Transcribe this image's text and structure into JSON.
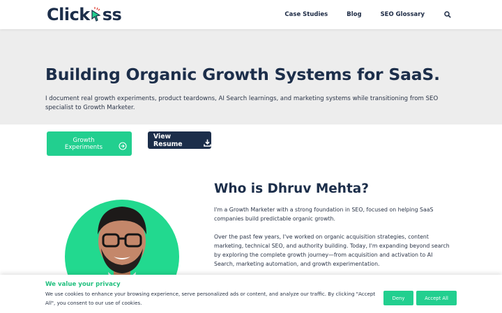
{
  "header": {
    "logo": {
      "text_left": "Click",
      "text_right": "ss",
      "icon": "cursor-icon"
    },
    "nav": [
      {
        "label": "Case Studies"
      },
      {
        "label": "Blog"
      },
      {
        "label": "SEO Glossary"
      }
    ],
    "search_icon": "search-icon"
  },
  "hero": {
    "title": "Building Organic Growth Systems for SaaS.",
    "subtitle": "I document real growth experiments, product teardowns, AI Search learnings, and marketing systems while transitioning from SEO specialist to Growth Marketer."
  },
  "buttons": {
    "primary_label": "Growth Experiments",
    "primary_icon": "arrow-right-circle-icon",
    "secondary_label": "View Resume",
    "secondary_icon": "download-icon"
  },
  "about": {
    "title": "Who is Dhruv Mehta?",
    "paragraph1": "I'm a Growth Marketer with a strong foundation in SEO, focused on helping SaaS companies build predictable organic growth.",
    "paragraph2": "Over the past few years, I've worked on organic acquisition strategies, content marketing, technical SEO, and authority building. Today, I'm expanding beyond search by exploring the complete growth journey—from acquisition and activation to AI Search, marketing automation, and growth experimentation."
  },
  "cookie": {
    "title": "We value your privacy",
    "text": "We use cookies to enhance your browsing experience, serve personalized ads or content, and analyze our traffic. By clicking \"Accept All\", you consent to our use of cookies.",
    "deny_label": "Deny",
    "accept_label": "Accept All"
  },
  "colors": {
    "accent_green": "#22cf8f",
    "navy": "#1c2e4a",
    "hero_bg": "#ededed"
  }
}
